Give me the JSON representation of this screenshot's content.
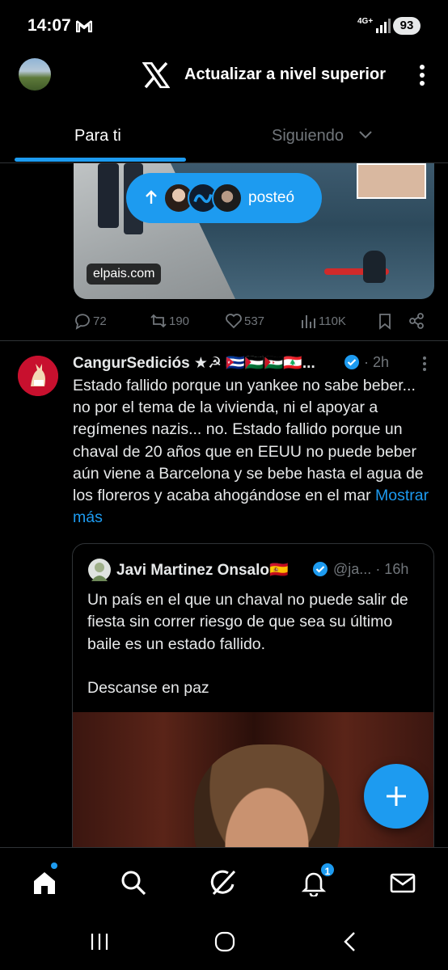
{
  "status_bar": {
    "time": "14:07",
    "network": "4G+",
    "battery": "93"
  },
  "header": {
    "upgrade_label": "Actualizar a nivel superior"
  },
  "tabs": [
    {
      "label": "Para ti",
      "active": true
    },
    {
      "label": "Siguiendo",
      "active": false
    }
  ],
  "first_post": {
    "source": "elpais.com",
    "posted_pill": "posteó",
    "replies": "72",
    "reposts": "190",
    "likes": "537",
    "views": "110K"
  },
  "tweet": {
    "name": "CangurSediciós ★☭ 🇨🇺🇵🇸🇪🇭🇱🇧...",
    "time": "· 2h",
    "text": "Estado fallido porque un yankee no sabe beber... no por el tema de la vivienda, ni el apoyar a regímenes nazis... no. Estado fallido porque un chaval de 20 años que en EEUU no puede beber aún viene a Barcelona y se bebe hasta el agua de los floreros y acaba ahogándose en el mar",
    "show_more": "Mostrar más"
  },
  "quote": {
    "name": "Javi Martinez Onsalo🇪🇸",
    "handle": "@ja...",
    "time": "· 16h",
    "text_1": "Un país en el que un chaval no puede salir de fiesta sin correr riesgo de que sea su último baile es un estado fallido.",
    "text_2": "Descanse en paz"
  },
  "bottom_nav": {
    "notification_count": "1"
  },
  "colors": {
    "accent": "#1d9bf0",
    "background": "#000000",
    "muted": "#71767b"
  }
}
